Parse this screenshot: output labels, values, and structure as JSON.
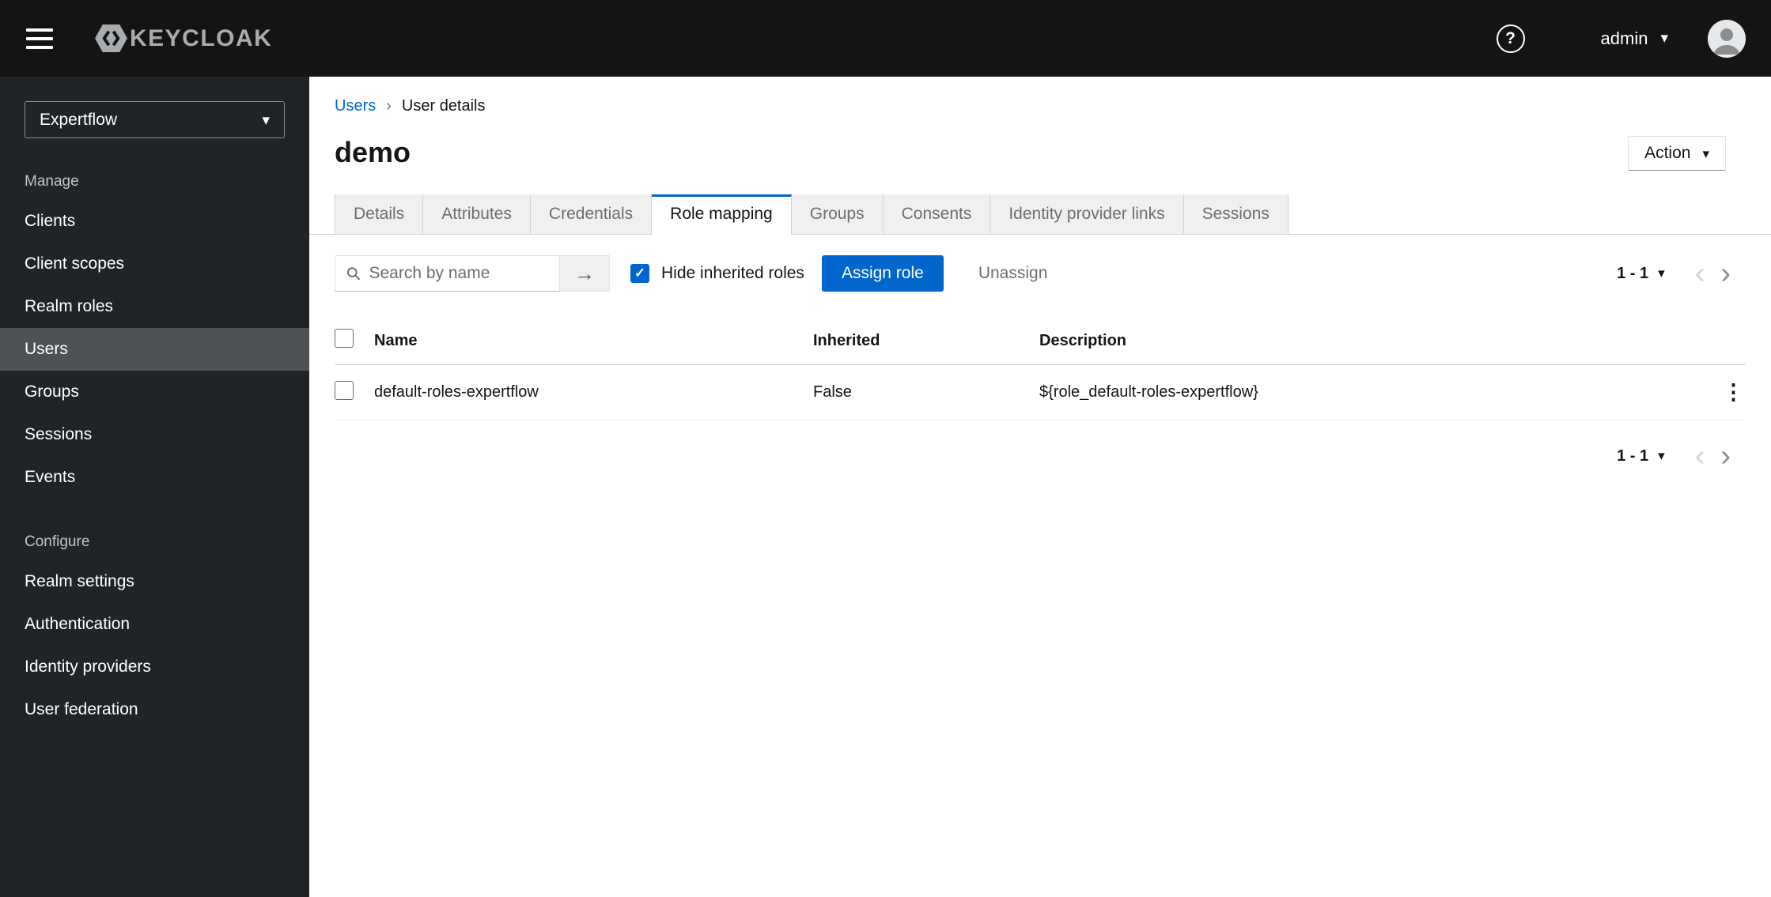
{
  "header": {
    "brand": "KEYCLOAK",
    "user": "admin"
  },
  "sidebar": {
    "realm": "Expertflow",
    "groups": [
      {
        "label": "Manage",
        "items": [
          "Clients",
          "Client scopes",
          "Realm roles",
          "Users",
          "Groups",
          "Sessions",
          "Events"
        ]
      },
      {
        "label": "Configure",
        "items": [
          "Realm settings",
          "Authentication",
          "Identity providers",
          "User federation"
        ]
      }
    ]
  },
  "breadcrumb": {
    "items": [
      "Users",
      "User details"
    ]
  },
  "page": {
    "title": "demo",
    "action_label": "Action"
  },
  "tabs": {
    "items": [
      "Details",
      "Attributes",
      "Credentials",
      "Role mapping",
      "Groups",
      "Consents",
      "Identity provider links",
      "Sessions"
    ],
    "active": "Role mapping"
  },
  "toolbar": {
    "search_placeholder": "Search by name",
    "hide_inherited_label": "Hide inherited roles",
    "assign_label": "Assign role",
    "unassign_label": "Unassign",
    "pagination_range": "1 - 1"
  },
  "table": {
    "headers": [
      "Name",
      "Inherited",
      "Description"
    ],
    "rows": [
      {
        "name": "default-roles-expertflow",
        "inherited": "False",
        "description": "${role_default-roles-expertflow}"
      }
    ]
  },
  "pagination_bottom": {
    "range": "1 - 1"
  },
  "colors": {
    "primary": "#0066cc",
    "masthead": "#141414",
    "sidebar": "#212427",
    "sidebar_current": "#4f5255"
  }
}
